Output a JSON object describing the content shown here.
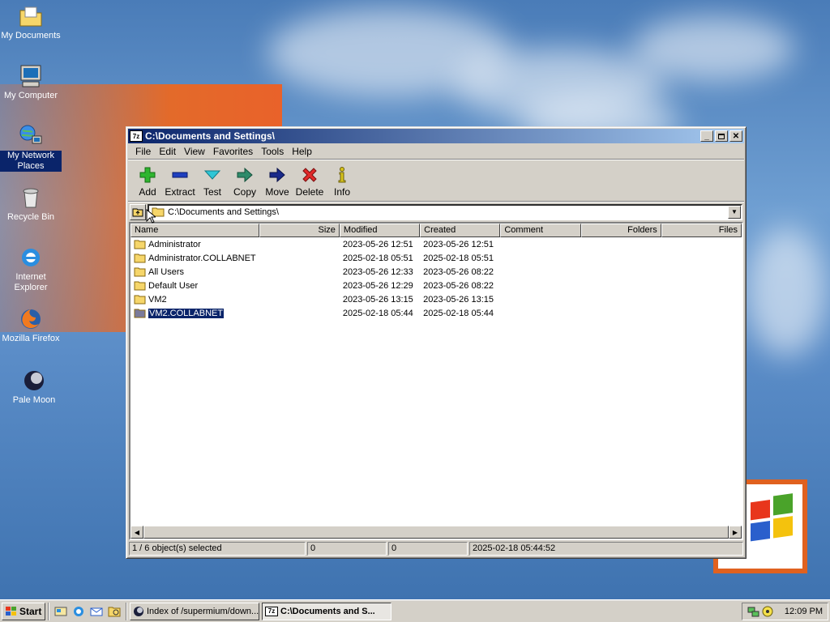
{
  "desktop": {
    "icons": [
      {
        "label": "My Documents"
      },
      {
        "label": "My Computer"
      },
      {
        "label": "My Network Places"
      },
      {
        "label": "Recycle Bin"
      },
      {
        "label": "Internet Explorer"
      },
      {
        "label": "Mozilla Firefox"
      },
      {
        "label": "Pale Moon"
      }
    ]
  },
  "window": {
    "title": "C:\\Documents and Settings\\",
    "app_icon_text": "7z",
    "menu": [
      "File",
      "Edit",
      "View",
      "Favorites",
      "Tools",
      "Help"
    ],
    "toolbar": [
      {
        "label": "Add",
        "icon": "add-icon"
      },
      {
        "label": "Extract",
        "icon": "extract-icon"
      },
      {
        "label": "Test",
        "icon": "test-icon"
      },
      {
        "label": "Copy",
        "icon": "copy-icon"
      },
      {
        "label": "Move",
        "icon": "move-icon"
      },
      {
        "label": "Delete",
        "icon": "delete-icon"
      },
      {
        "label": "Info",
        "icon": "info-icon"
      }
    ],
    "address": "C:\\Documents and Settings\\",
    "columns": [
      "Name",
      "Size",
      "Modified",
      "Created",
      "Comment",
      "Folders",
      "Files"
    ],
    "rows": [
      {
        "name": "Administrator",
        "size": "",
        "modified": "2023-05-26 12:51",
        "created": "2023-05-26 12:51",
        "comment": "",
        "folders": "",
        "files": ""
      },
      {
        "name": "Administrator.COLLABNET",
        "size": "",
        "modified": "2025-02-18 05:51",
        "created": "2025-02-18 05:51",
        "comment": "",
        "folders": "",
        "files": ""
      },
      {
        "name": "All Users",
        "size": "",
        "modified": "2023-05-26 12:33",
        "created": "2023-05-26 08:22",
        "comment": "",
        "folders": "",
        "files": ""
      },
      {
        "name": "Default User",
        "size": "",
        "modified": "2023-05-26 12:29",
        "created": "2023-05-26 08:22",
        "comment": "",
        "folders": "",
        "files": ""
      },
      {
        "name": "VM2",
        "size": "",
        "modified": "2023-05-26 13:15",
        "created": "2023-05-26 13:15",
        "comment": "",
        "folders": "",
        "files": ""
      },
      {
        "name": "VM2.COLLABNET",
        "size": "",
        "modified": "2025-02-18 05:44",
        "created": "2025-02-18 05:44",
        "comment": "",
        "folders": "",
        "files": "",
        "selected": true
      }
    ],
    "status": {
      "selection": "1 / 6 object(s) selected",
      "size1": "0",
      "size2": "0",
      "datetime": "2025-02-18 05:44:52"
    }
  },
  "taskbar": {
    "start_label": "Start",
    "tasks": [
      {
        "label": "Index of /supermium/down..."
      },
      {
        "label": "C:\\Documents and S...",
        "app_icon_text": "7z",
        "active": true
      }
    ],
    "clock": "12:09 PM"
  },
  "colors": {
    "desktop": "#3a6ea5",
    "title_active": "#0a246a",
    "selection": "#0a246a",
    "face": "#d4d0c8"
  }
}
